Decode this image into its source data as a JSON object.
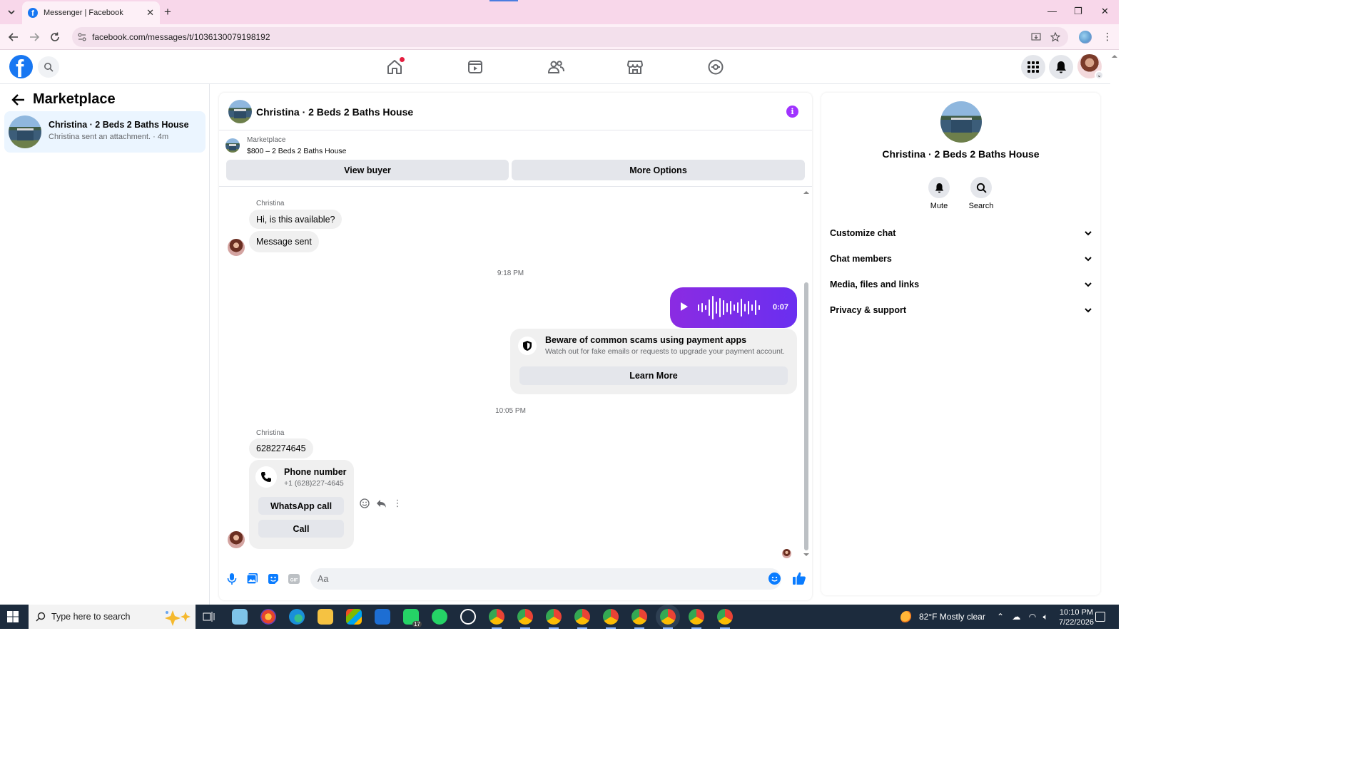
{
  "browser": {
    "tab_title": "Messenger | Facebook",
    "tab_close": "✕",
    "new_tab": "+",
    "url": "facebook.com/messages/t/1036130079198192",
    "window_controls": [
      "—",
      "❐",
      "✕"
    ]
  },
  "header": {
    "logo_letter": "f",
    "nav_icons": [
      "home-icon",
      "video-icon",
      "friends-icon",
      "marketplace-icon",
      "gaming-icon"
    ],
    "home_has_notification": true
  },
  "left_panel": {
    "heading": "Marketplace",
    "conversations": [
      {
        "name": "Christina · 2 Beds 2 Baths House",
        "preview": "Christina sent an attachment. · 4m"
      }
    ]
  },
  "chat": {
    "title": "Christina · 2 Beds 2 Baths House",
    "info_glyph": "i",
    "listing": {
      "label": "Marketplace",
      "text": "$800 – 2 Beds 2 Baths House"
    },
    "view_buyer": "View buyer",
    "more_options": "More Options",
    "messages": {
      "sender1": "Christina",
      "msg1": "Hi, is this available?",
      "msg2": "Message sent",
      "time1": "9:18 PM",
      "voice_duration": "0:07",
      "scam_title": "Beware of common scams using payment apps",
      "scam_body": "Watch out for fake emails or requests to upgrade your payment account.",
      "learn_more": "Learn More",
      "time2": "10:05 PM",
      "sender2": "Christina",
      "msg3": "6282274645",
      "phone_title": "Phone number",
      "phone_value": "+1 (628)227-4645",
      "whatsapp_call": "WhatsApp call",
      "call": "Call"
    },
    "composer_placeholder": "Aa"
  },
  "right_panel": {
    "title": "Christina · 2 Beds 2 Baths House",
    "actions": [
      "Mute",
      "Search"
    ],
    "sections": [
      "Customize chat",
      "Chat members",
      "Media, files and links",
      "Privacy & support"
    ]
  },
  "taskbar": {
    "search_placeholder": "Type here to search",
    "weather": "82°F  Mostly clear",
    "time": "10:10 PM",
    "date": "7/22/2026",
    "whatsapp_badge": "17"
  },
  "colors": {
    "brand_blue": "#1877f2",
    "voice_purple": "#7c3aed",
    "info_purple": "#a033ff",
    "tab_bar_pink": "#f8d7ea",
    "selected_conversation": "#ebf5ff"
  }
}
